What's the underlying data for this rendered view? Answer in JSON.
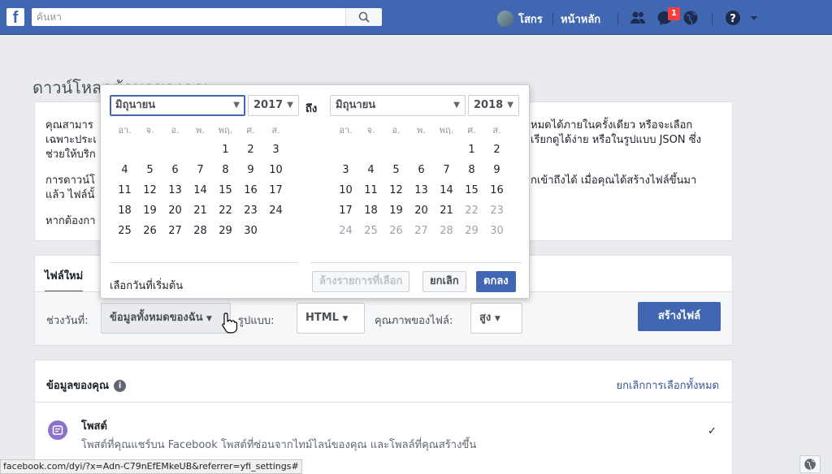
{
  "topbar": {
    "search_placeholder": "ค้นหา",
    "profile_name": "โสกร",
    "home_label": "หน้าหลัก",
    "notification_count": "1",
    "help_label": "?"
  },
  "page": {
    "title": "ดาวน์โหลดข้อมูลของคุณ",
    "intro_lines_left": [
      "คุณสามาร",
      "เฉพาะประเ",
      "ช่วยให้บริก",
      "การดาวน์โ",
      "แล้ว ไฟล์นั้",
      "หากต้องกา"
    ],
    "intro_lines_right": [
      "หมดได้ภายในครั้งเดียว หรือจะเลือก",
      "เรียกดูได้ง่าย หรือในรูปแบบ JSON ซึ่ง",
      "",
      "กเข้าถึงได้ เมื่อคุณได้สร้างไฟล์ขึ้นมา"
    ]
  },
  "new_file": {
    "tab_label": "ไฟล์ใหม่",
    "date_range_label": "ช่วงวันที่:",
    "date_range_value": "ข้อมูลทั้งหมดของฉัน",
    "format_label": "รูปแบบ:",
    "format_value": "HTML",
    "quality_label": "คุณภาพของไฟล์:",
    "quality_value": "สูง",
    "create_button": "สร้างไฟล์"
  },
  "date_picker": {
    "to_label": "ถึง",
    "start": {
      "month": "มิถุนายน",
      "year": "2017"
    },
    "end": {
      "month": "มิถุนายน",
      "year": "2018"
    },
    "weekdays": [
      "อา.",
      "จ.",
      "อ.",
      "พ.",
      "พฤ.",
      "ศ.",
      "ส."
    ],
    "start_weeks": [
      [
        "",
        "",
        "",
        "",
        "1",
        "2",
        "3"
      ],
      [
        "4",
        "5",
        "6",
        "7",
        "8",
        "9",
        "10"
      ],
      [
        "11",
        "12",
        "13",
        "14",
        "15",
        "16",
        "17"
      ],
      [
        "18",
        "19",
        "20",
        "21",
        "22",
        "23",
        "24"
      ],
      [
        "25",
        "26",
        "27",
        "28",
        "29",
        "30",
        ""
      ]
    ],
    "end_weeks": [
      [
        "",
        "",
        "",
        "",
        "",
        "1",
        "2"
      ],
      [
        "3",
        "4",
        "5",
        "6",
        "7",
        "8",
        "9"
      ],
      [
        "10",
        "11",
        "12",
        "13",
        "14",
        "15",
        "16"
      ],
      [
        "17",
        "18",
        "19",
        "20",
        "21",
        "22",
        "23"
      ],
      [
        "24",
        "25",
        "26",
        "27",
        "28",
        "29",
        "30"
      ]
    ],
    "end_dimmed_from": "22",
    "hint": "เลือกวันที่เริ่มต้น",
    "clear_button": "ล้างรายการที่เลือก",
    "cancel_button": "ยกเลิก",
    "ok_button": "ตกลง"
  },
  "your_info": {
    "title": "ข้อมูลของคุณ",
    "deselect_all": "ยกเลิกการเลือกทั้งหมด",
    "items": [
      {
        "title": "โพสต์",
        "description": "โพสต์ที่คุณแชร์บน Facebook โพสต์ที่ซ่อนจากไทม์ไลน์ของคุณ และโพลล์ที่คุณสร้างขึ้น",
        "checked": "✓"
      }
    ]
  },
  "status_bar": {
    "url": "facebook.com/dyi/?x=Adn-C79nEfEMkeUB&referrer=yfi_settings#"
  },
  "colors": {
    "brand": "#4267b2",
    "badge": "#fa3e3e",
    "post_icon": "#8c72cb"
  }
}
